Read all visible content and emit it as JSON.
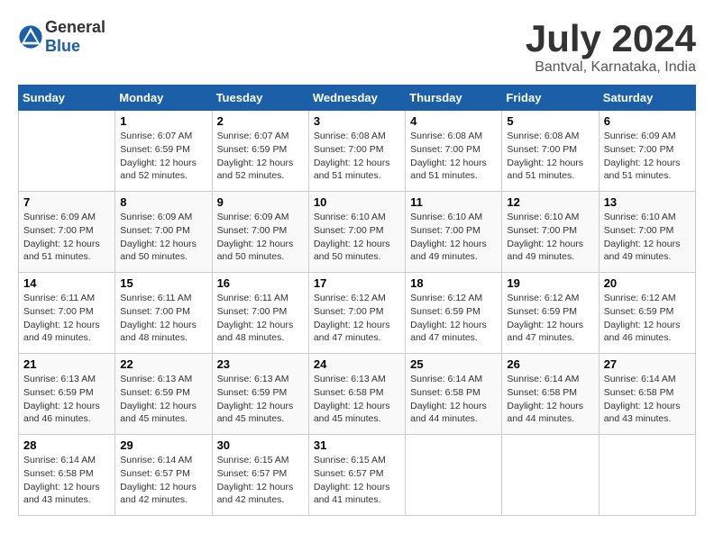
{
  "header": {
    "logo_general": "General",
    "logo_blue": "Blue",
    "title": "July 2024",
    "subtitle": "Bantval, Karnataka, India"
  },
  "columns": [
    "Sunday",
    "Monday",
    "Tuesday",
    "Wednesday",
    "Thursday",
    "Friday",
    "Saturday"
  ],
  "weeks": [
    [
      {
        "day": "",
        "info": ""
      },
      {
        "day": "1",
        "info": "Sunrise: 6:07 AM\nSunset: 6:59 PM\nDaylight: 12 hours\nand 52 minutes."
      },
      {
        "day": "2",
        "info": "Sunrise: 6:07 AM\nSunset: 6:59 PM\nDaylight: 12 hours\nand 52 minutes."
      },
      {
        "day": "3",
        "info": "Sunrise: 6:08 AM\nSunset: 7:00 PM\nDaylight: 12 hours\nand 51 minutes."
      },
      {
        "day": "4",
        "info": "Sunrise: 6:08 AM\nSunset: 7:00 PM\nDaylight: 12 hours\nand 51 minutes."
      },
      {
        "day": "5",
        "info": "Sunrise: 6:08 AM\nSunset: 7:00 PM\nDaylight: 12 hours\nand 51 minutes."
      },
      {
        "day": "6",
        "info": "Sunrise: 6:09 AM\nSunset: 7:00 PM\nDaylight: 12 hours\nand 51 minutes."
      }
    ],
    [
      {
        "day": "7",
        "info": "Sunrise: 6:09 AM\nSunset: 7:00 PM\nDaylight: 12 hours\nand 51 minutes."
      },
      {
        "day": "8",
        "info": "Sunrise: 6:09 AM\nSunset: 7:00 PM\nDaylight: 12 hours\nand 50 minutes."
      },
      {
        "day": "9",
        "info": "Sunrise: 6:09 AM\nSunset: 7:00 PM\nDaylight: 12 hours\nand 50 minutes."
      },
      {
        "day": "10",
        "info": "Sunrise: 6:10 AM\nSunset: 7:00 PM\nDaylight: 12 hours\nand 50 minutes."
      },
      {
        "day": "11",
        "info": "Sunrise: 6:10 AM\nSunset: 7:00 PM\nDaylight: 12 hours\nand 49 minutes."
      },
      {
        "day": "12",
        "info": "Sunrise: 6:10 AM\nSunset: 7:00 PM\nDaylight: 12 hours\nand 49 minutes."
      },
      {
        "day": "13",
        "info": "Sunrise: 6:10 AM\nSunset: 7:00 PM\nDaylight: 12 hours\nand 49 minutes."
      }
    ],
    [
      {
        "day": "14",
        "info": "Sunrise: 6:11 AM\nSunset: 7:00 PM\nDaylight: 12 hours\nand 49 minutes."
      },
      {
        "day": "15",
        "info": "Sunrise: 6:11 AM\nSunset: 7:00 PM\nDaylight: 12 hours\nand 48 minutes."
      },
      {
        "day": "16",
        "info": "Sunrise: 6:11 AM\nSunset: 7:00 PM\nDaylight: 12 hours\nand 48 minutes."
      },
      {
        "day": "17",
        "info": "Sunrise: 6:12 AM\nSunset: 7:00 PM\nDaylight: 12 hours\nand 47 minutes."
      },
      {
        "day": "18",
        "info": "Sunrise: 6:12 AM\nSunset: 6:59 PM\nDaylight: 12 hours\nand 47 minutes."
      },
      {
        "day": "19",
        "info": "Sunrise: 6:12 AM\nSunset: 6:59 PM\nDaylight: 12 hours\nand 47 minutes."
      },
      {
        "day": "20",
        "info": "Sunrise: 6:12 AM\nSunset: 6:59 PM\nDaylight: 12 hours\nand 46 minutes."
      }
    ],
    [
      {
        "day": "21",
        "info": "Sunrise: 6:13 AM\nSunset: 6:59 PM\nDaylight: 12 hours\nand 46 minutes."
      },
      {
        "day": "22",
        "info": "Sunrise: 6:13 AM\nSunset: 6:59 PM\nDaylight: 12 hours\nand 45 minutes."
      },
      {
        "day": "23",
        "info": "Sunrise: 6:13 AM\nSunset: 6:59 PM\nDaylight: 12 hours\nand 45 minutes."
      },
      {
        "day": "24",
        "info": "Sunrise: 6:13 AM\nSunset: 6:58 PM\nDaylight: 12 hours\nand 45 minutes."
      },
      {
        "day": "25",
        "info": "Sunrise: 6:14 AM\nSunset: 6:58 PM\nDaylight: 12 hours\nand 44 minutes."
      },
      {
        "day": "26",
        "info": "Sunrise: 6:14 AM\nSunset: 6:58 PM\nDaylight: 12 hours\nand 44 minutes."
      },
      {
        "day": "27",
        "info": "Sunrise: 6:14 AM\nSunset: 6:58 PM\nDaylight: 12 hours\nand 43 minutes."
      }
    ],
    [
      {
        "day": "28",
        "info": "Sunrise: 6:14 AM\nSunset: 6:58 PM\nDaylight: 12 hours\nand 43 minutes."
      },
      {
        "day": "29",
        "info": "Sunrise: 6:14 AM\nSunset: 6:57 PM\nDaylight: 12 hours\nand 42 minutes."
      },
      {
        "day": "30",
        "info": "Sunrise: 6:15 AM\nSunset: 6:57 PM\nDaylight: 12 hours\nand 42 minutes."
      },
      {
        "day": "31",
        "info": "Sunrise: 6:15 AM\nSunset: 6:57 PM\nDaylight: 12 hours\nand 41 minutes."
      },
      {
        "day": "",
        "info": ""
      },
      {
        "day": "",
        "info": ""
      },
      {
        "day": "",
        "info": ""
      }
    ]
  ]
}
